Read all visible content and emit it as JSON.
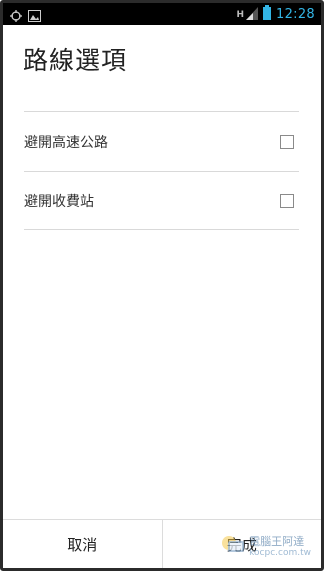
{
  "statusbar": {
    "time": "12:28",
    "network_label": "H",
    "icons": [
      "sync-icon",
      "image-notification-icon",
      "signal-icon",
      "battery-icon"
    ]
  },
  "dialog": {
    "title": "路線選項",
    "options": [
      {
        "label": "避開高速公路",
        "checked": false
      },
      {
        "label": "避開收費站",
        "checked": false
      }
    ]
  },
  "footer": {
    "cancel_label": "取消",
    "done_label": "完成"
  },
  "watermark": {
    "brand": "電腦王阿達",
    "url": "kocpc.com.tw"
  },
  "colors": {
    "status_bar_bg": "#000000",
    "clock": "#33b5e5",
    "divider": "#d9d9d9"
  }
}
